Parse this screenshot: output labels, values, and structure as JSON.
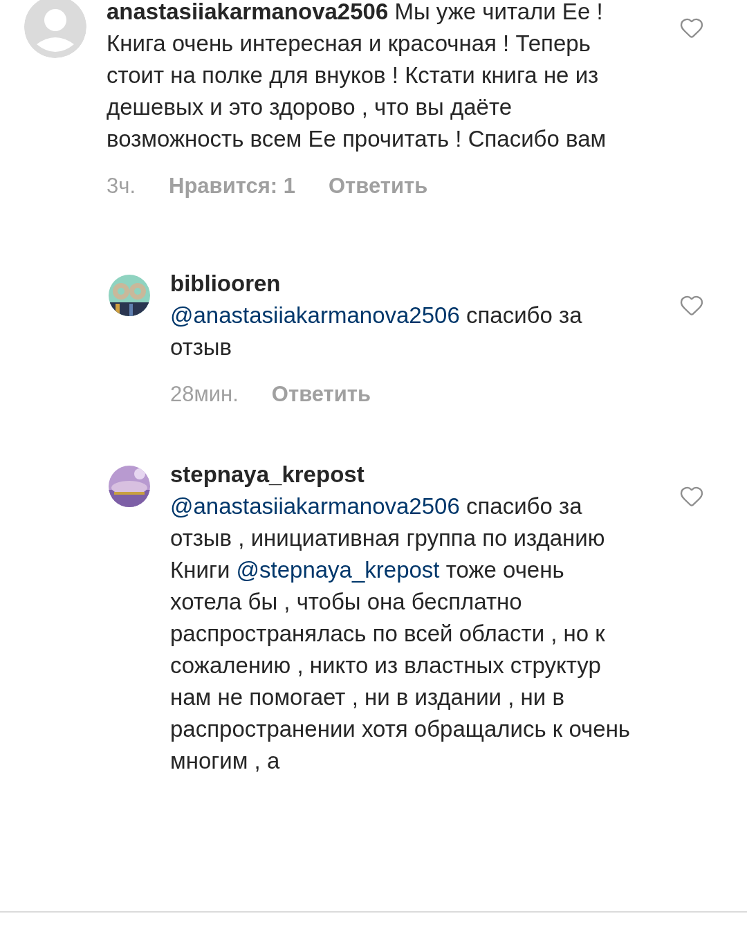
{
  "comments": [
    {
      "kind": "comment",
      "avatar": {
        "kind": "placeholder"
      },
      "segments": [
        {
          "kind": "username",
          "text": "anastasiiakarmanova2506"
        },
        {
          "kind": "text",
          "text": " Мы  уже читали Ее ! Книга очень интересная и красочная ! Теперь стоит на полке для внуков ! Кстати книга не из дешевых и это здорово , что вы даёте возможность всем Ее прочитать ! Спасибо вам"
        }
      ],
      "time": "3ч.",
      "likes": "Нравится: 1",
      "reply": "Ответить"
    },
    {
      "kind": "reply",
      "avatar": {
        "kind": "picture"
      },
      "username": "bibliooren",
      "segments": [
        {
          "kind": "mention",
          "text": "@anastasiiakarmanova2506"
        },
        {
          "kind": "text",
          "text": " спасибо за отзыв"
        }
      ],
      "time": "28мин.",
      "reply": "Ответить"
    },
    {
      "kind": "reply",
      "avatar": {
        "kind": "picture"
      },
      "username": "stepnaya_krepost",
      "segments": [
        {
          "kind": "mention",
          "text": "@anastasiiakarmanova2506"
        },
        {
          "kind": "text",
          "text": " спасибо за отзыв , инициативная группа  по изданию Книги "
        },
        {
          "kind": "mention",
          "text": "@stepnaya_krepost"
        },
        {
          "kind": "text",
          "text": " тоже очень хотела бы , чтобы она бесплатно распространялась по всей области , но к сожалению , никто из властных структур нам не помогает , ни в издании , ни в распространении хотя обращались к очень многим , а"
        }
      ]
    }
  ]
}
